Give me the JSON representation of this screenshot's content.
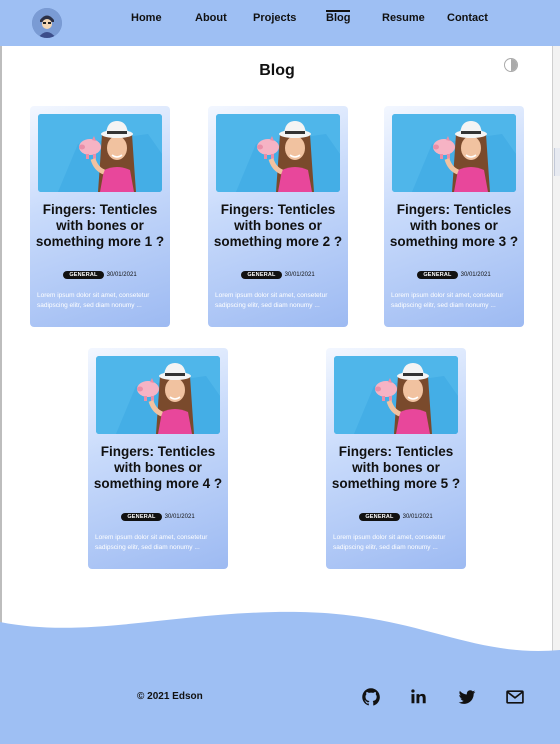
{
  "nav": {
    "items": [
      {
        "label": "Home"
      },
      {
        "label": "About"
      },
      {
        "label": "Projects"
      },
      {
        "label": "Blog",
        "active": true
      },
      {
        "label": "Resume"
      },
      {
        "label": "Contact"
      }
    ]
  },
  "page": {
    "title": "Blog"
  },
  "posts": [
    {
      "title": "Fingers: Tenticles with bones or something more 1 ?",
      "category": "GENERAL",
      "date": "30/01/2021",
      "excerpt": "Lorem ipsum dolor sit amet, consetetur sadipscing elitr, sed diam nonumy ..."
    },
    {
      "title": "Fingers: Tenticles with bones or something more 2 ?",
      "category": "GENERAL",
      "date": "30/01/2021",
      "excerpt": "Lorem ipsum dolor sit amet, consetetur sadipscing elitr, sed diam nonumy ..."
    },
    {
      "title": "Fingers: Tenticles with bones or something more 3 ?",
      "category": "GENERAL",
      "date": "30/01/2021",
      "excerpt": "Lorem ipsum dolor sit amet, consetetur sadipscing elitr, sed diam nonumy ..."
    },
    {
      "title": "Fingers: Tenticles with bones or something more 4 ?",
      "category": "GENERAL",
      "date": "30/01/2021",
      "excerpt": "Lorem ipsum dolor sit amet, consetetur sadipscing elitr, sed diam nonumy ..."
    },
    {
      "title": "Fingers: Tenticles with bones or something more 5 ?",
      "category": "GENERAL",
      "date": "30/01/2021",
      "excerpt": "Lorem ipsum dolor sit amet, consetetur sadipscing elitr, sed diam nonumy ..."
    }
  ],
  "footer": {
    "copyright": "© 2021 Edson",
    "social": [
      "github-icon",
      "linkedin-icon",
      "twitter-icon",
      "mail-icon"
    ]
  },
  "colors": {
    "header": "#9ebff3",
    "footer": "#9ebff3",
    "card_gradient_end": "#9dbaf2"
  }
}
